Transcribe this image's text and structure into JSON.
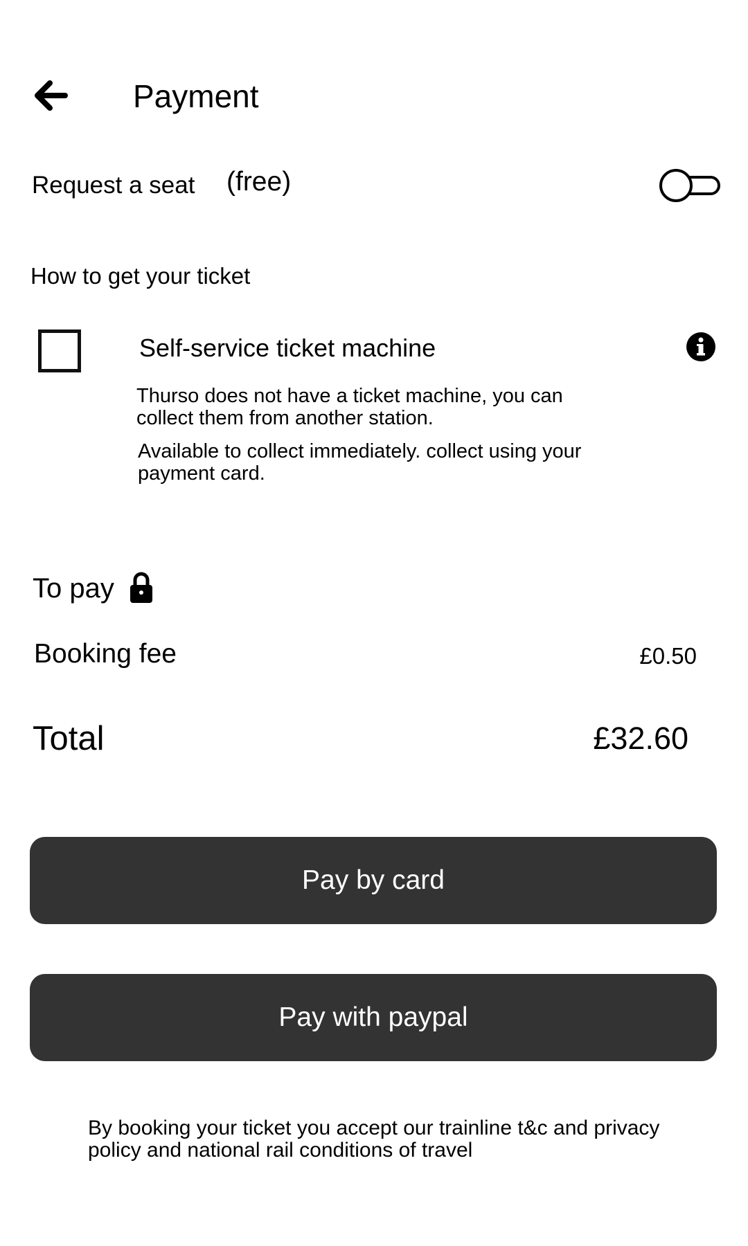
{
  "header": {
    "back_icon": "arrow-left-icon",
    "title": "Payment"
  },
  "seat": {
    "label": "Request a seat",
    "price_note": "(free)",
    "toggle_on": false
  },
  "ticket": {
    "heading": "How to get your ticket",
    "option": {
      "label": "Self-service ticket machine",
      "checked": false,
      "info_icon": "info-icon",
      "notes": [
        "Thurso does not have a ticket machine, you can collect them from another station.",
        "Available to collect immediately. collect using your payment card."
      ]
    }
  },
  "payment": {
    "heading": "To pay",
    "lock_icon": "lock-icon",
    "booking_fee_label": "Booking fee",
    "booking_fee_value": "£0.50",
    "total_label": "Total",
    "total_value": "£32.60"
  },
  "actions": {
    "pay_card_label": "Pay by card",
    "pay_paypal_label": "Pay with paypal",
    "button_color": "#333333"
  },
  "footer": {
    "terms": "By booking your ticket you accept our trainline t&c and privacy policy and national rail conditions of travel"
  }
}
